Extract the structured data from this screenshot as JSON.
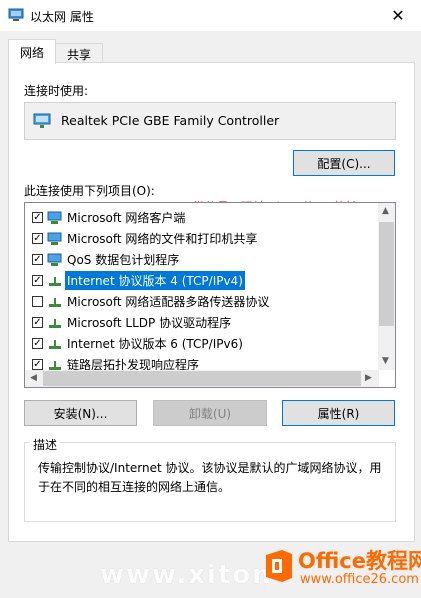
{
  "window": {
    "title": "以太网 属性",
    "close_glyph": "✕"
  },
  "tabs": [
    {
      "label": "网络"
    },
    {
      "label": "共享"
    }
  ],
  "connect_using": {
    "label": "连接时使用:",
    "adapter": "Realtek PCIe GBE Family Controller",
    "configure_button": "配置(C)..."
  },
  "items_label": "此连接使用下列项目(O):",
  "items": [
    {
      "label": "Microsoft 网络客户端",
      "checked": true
    },
    {
      "label": "Microsoft 网络的文件和打印机共享",
      "checked": true
    },
    {
      "label": "QoS 数据包计划程序",
      "checked": true
    },
    {
      "label": "Internet 协议版本 4 (TCP/IPv4)",
      "checked": true
    },
    {
      "label": "Microsoft 网络适配器多路传送器协议",
      "checked": false
    },
    {
      "label": "Microsoft LLDP 协议驱动程序",
      "checked": true
    },
    {
      "label": "Internet 协议版本 6 (TCP/IPv6)",
      "checked": true
    },
    {
      "label": "链路层拓扑发现响应程序",
      "checked": true
    }
  ],
  "buttons": {
    "install": "安装(N)...",
    "uninstall": "卸载(U)",
    "properties": "属性(R)"
  },
  "description": {
    "title": "描述",
    "text": "传输控制协议/Internet 协议。该协议是默认的广域网络协议，用于在不同的相互连接的网络上通信。"
  },
  "watermarks": {
    "author": "微信号：玩转Win10的MS酋长",
    "site_title": "Office教程网",
    "site_url": "www.office26.com",
    "faint": "www.xiton"
  },
  "colors": {
    "accent": "#0078d7",
    "watermark_red": "#ff3b3b",
    "logo_orange": "#ff6a00"
  }
}
